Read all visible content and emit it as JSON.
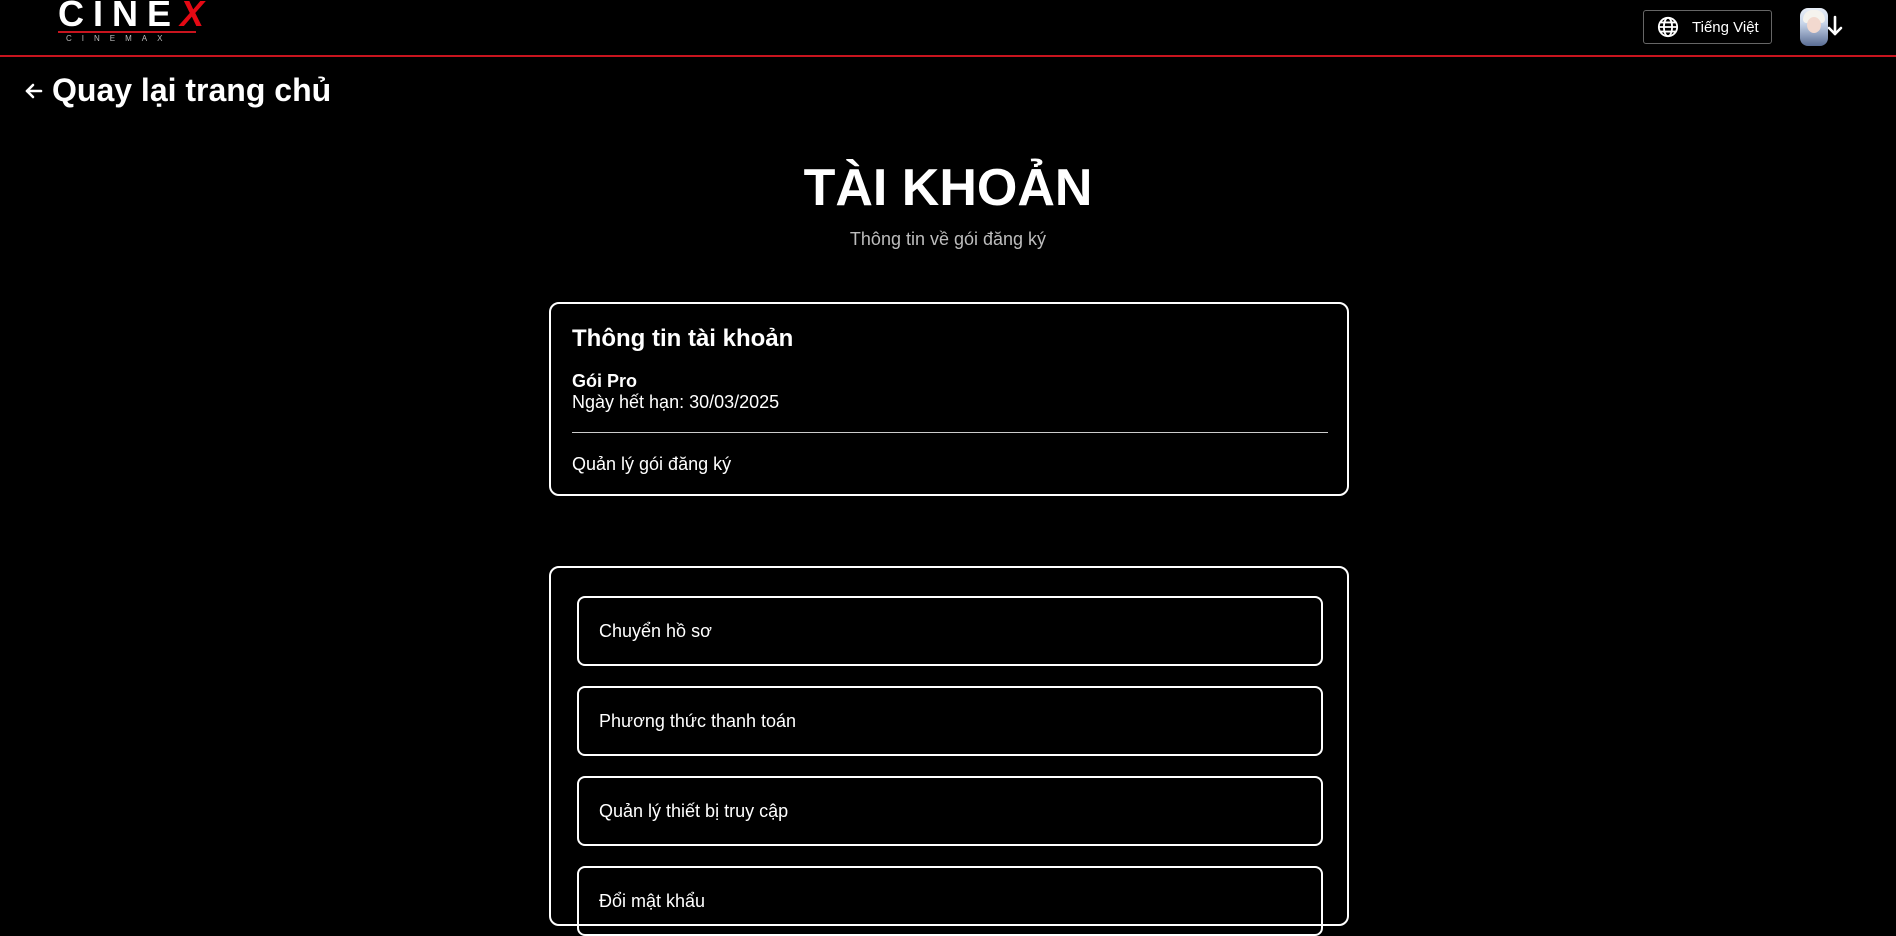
{
  "header": {
    "logo_main": "CINE",
    "logo_x": "X",
    "logo_sub": "CINEMAX",
    "language_label": "Tiếng Việt",
    "icons": {
      "language": "globe-icon",
      "avatar_menu": "arrow-down-icon"
    }
  },
  "nav": {
    "back_label": "Quay lại trang chủ",
    "back_icon": "arrow-left-icon"
  },
  "page": {
    "title": "TÀI KHOẢN",
    "subtitle": "Thông tin về gói đăng ký"
  },
  "account_card": {
    "title": "Thông tin tài khoản",
    "plan": "Gói Pro",
    "expiry": "Ngày hết hạn: 30/03/2025",
    "manage_label": "Quản lý gói đăng ký"
  },
  "menu": {
    "items": [
      {
        "label": "Chuyển hồ sơ"
      },
      {
        "label": "Phương thức thanh toán"
      },
      {
        "label": "Quản lý thiết bị truy cập"
      },
      {
        "label": "Đổi mật khẩu"
      }
    ]
  },
  "colors": {
    "background": "#000000",
    "accent": "#c8141e",
    "text": "#ffffff",
    "muted": "#bdbdbd"
  }
}
